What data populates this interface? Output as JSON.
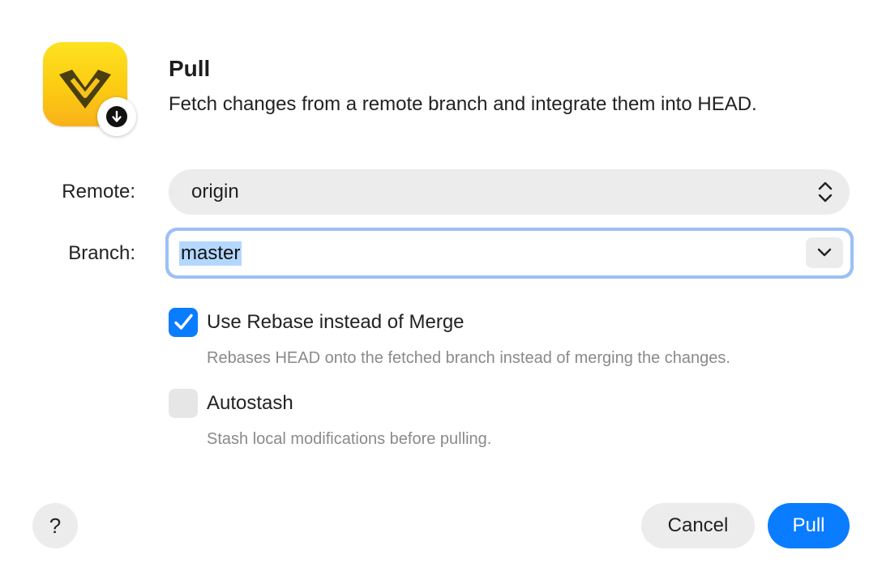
{
  "dialog": {
    "title": "Pull",
    "subtitle": "Fetch changes from a remote branch and integrate them into HEAD.",
    "app_icon": "fork-logo-icon",
    "badge_icon": "arrow-down-circle-icon"
  },
  "form": {
    "remote_label": "Remote:",
    "remote_value": "origin",
    "branch_label": "Branch:",
    "branch_value": "master"
  },
  "options": {
    "rebase": {
      "label": "Use Rebase instead of Merge",
      "description": "Rebases HEAD onto the fetched branch instead of merging the changes.",
      "checked": true
    },
    "autostash": {
      "label": "Autostash",
      "description": "Stash local modifications before pulling.",
      "checked": false
    }
  },
  "buttons": {
    "help": "?",
    "cancel": "Cancel",
    "pull": "Pull"
  },
  "colors": {
    "accent": "#0a7cff",
    "focus_ring": "#9cc0f5",
    "selection": "#b3d7ff",
    "icon_yellow": "#fccb13"
  }
}
